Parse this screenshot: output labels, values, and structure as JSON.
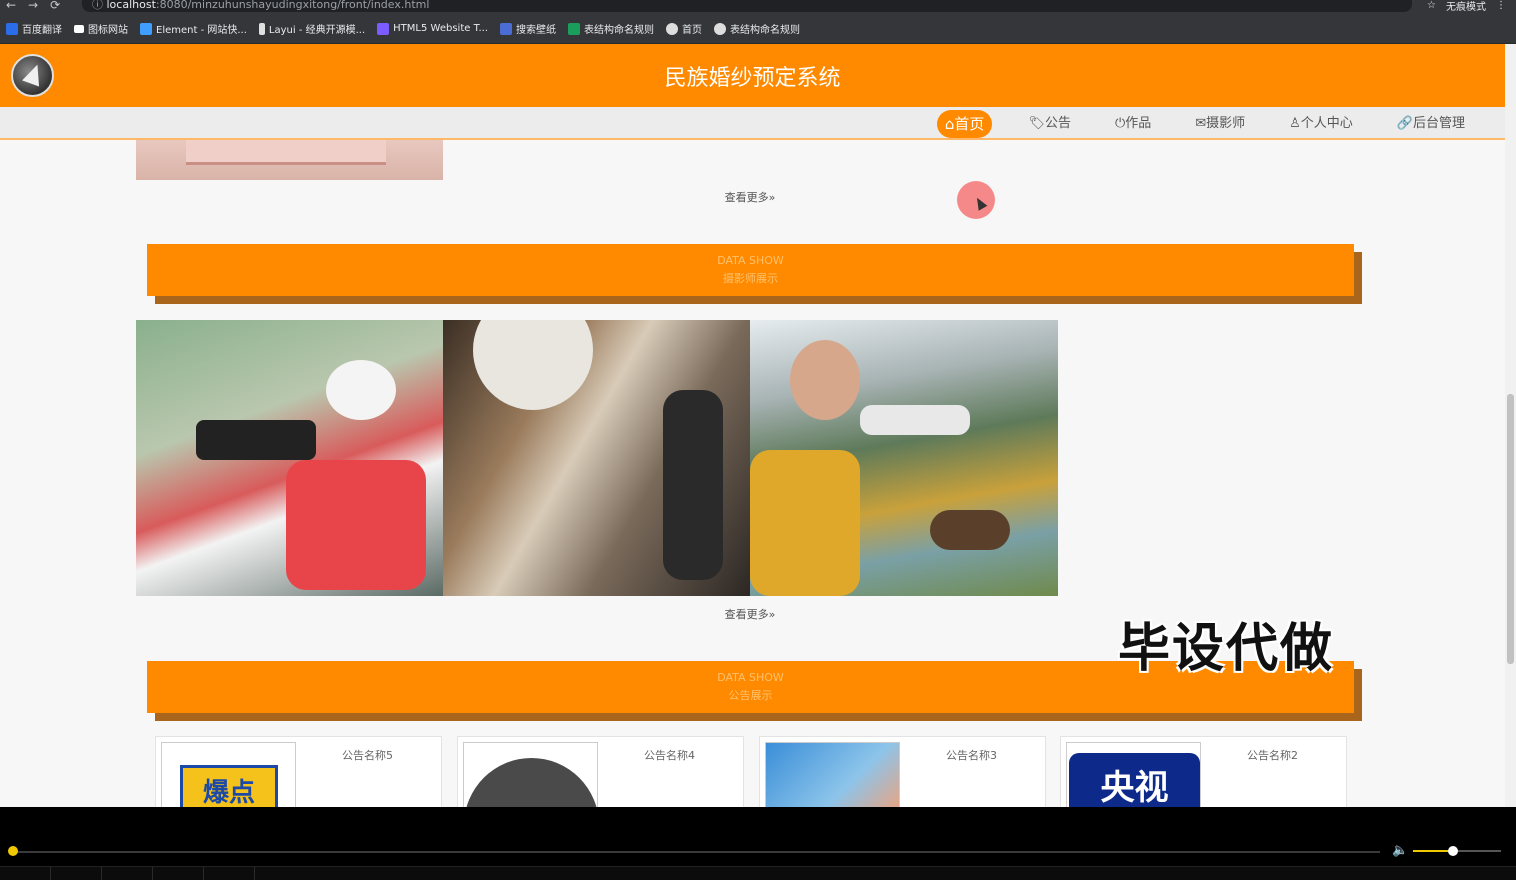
{
  "browser": {
    "url_host": "localhost",
    "url_path": ":8080/minzuhunshayudingxitong/front/index.html",
    "incognito_label": "无痕模式",
    "bookmarks": [
      {
        "label": "百度翻译",
        "color": "#2b6de8"
      },
      {
        "label": "图标网站",
        "color": "#ffffff"
      },
      {
        "label": "Element - 网站快...",
        "color": "#409eff"
      },
      {
        "label": "Layui - 经典开源模...",
        "color": "#e0e0e0"
      },
      {
        "label": "HTML5 Website T...",
        "color": "#7b5cff"
      },
      {
        "label": "搜索壁纸",
        "color": "#4a6cd4"
      },
      {
        "label": "表结构命名规则",
        "color": "#1a9e5c"
      },
      {
        "label": "首页",
        "color": "#dddddd"
      },
      {
        "label": "表结构命名规则",
        "color": "#dddddd"
      }
    ]
  },
  "site": {
    "title": "民族婚纱预定系统",
    "nav": [
      {
        "label": "⌂首页",
        "active": true
      },
      {
        "label": "🏷公告",
        "active": false
      },
      {
        "label": "⏻作品",
        "active": false
      },
      {
        "label": "✉摄影师",
        "active": false
      },
      {
        "label": "♙个人中心",
        "active": false
      },
      {
        "label": "🔗后台管理",
        "active": false
      }
    ],
    "accent_color": "#ff8a00"
  },
  "sections": {
    "top_more": "查看更多»",
    "photographers": {
      "en": "DATA SHOW",
      "zh": "摄影师展示",
      "more": "查看更多»"
    },
    "notices": {
      "en": "DATA SHOW",
      "zh": "公告展示"
    }
  },
  "notice_cards": [
    {
      "title": "公告名称5",
      "image_text": "爆点"
    },
    {
      "title": "公告名称4",
      "image_text": ""
    },
    {
      "title": "公告名称3",
      "image_text": ""
    },
    {
      "title": "公告名称2",
      "image_text": "央视"
    }
  ],
  "overlay": {
    "watermark": "毕设代做"
  }
}
